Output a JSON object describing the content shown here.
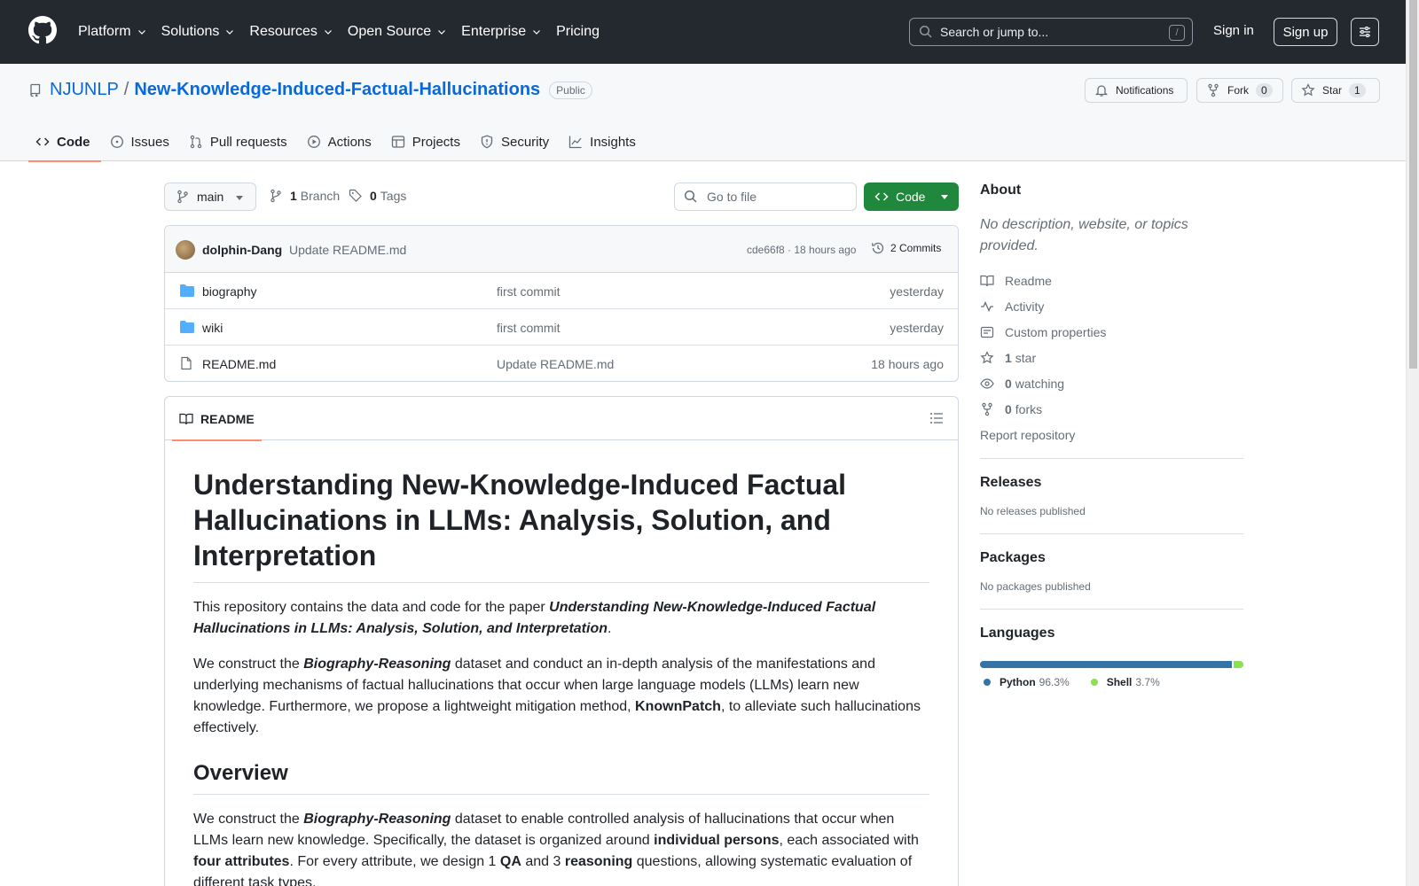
{
  "header": {
    "nav": [
      "Platform",
      "Solutions",
      "Resources",
      "Open Source",
      "Enterprise",
      "Pricing"
    ],
    "search_placeholder": "Search or jump to...",
    "search_shortcut": "/",
    "sign_in": "Sign in",
    "sign_up": "Sign up"
  },
  "repo": {
    "owner": "NJUNLP",
    "separator": "/",
    "name": "New-Knowledge-Induced-Factual-Hallucinations",
    "visibility": "Public",
    "notifications_label": "Notifications",
    "fork_label": "Fork",
    "fork_count": "0",
    "star_label": "Star",
    "star_count": "1"
  },
  "tabs": [
    "Code",
    "Issues",
    "Pull requests",
    "Actions",
    "Projects",
    "Security",
    "Insights"
  ],
  "toolbar": {
    "branch": "main",
    "branch_count": "1",
    "branch_label": "Branch",
    "tag_count": "0",
    "tag_label": "Tags",
    "goto_placeholder": "Go to file",
    "code_button": "Code"
  },
  "commit": {
    "author": "dolphin-Dang",
    "message": "Update README.md",
    "meta": "cde66f8 · 18 hours ago",
    "count": "2 Commits"
  },
  "files": [
    {
      "type": "folder",
      "name": "biography",
      "message": "first commit",
      "time": "yesterday"
    },
    {
      "type": "folder",
      "name": "wiki",
      "message": "first commit",
      "time": "yesterday"
    },
    {
      "type": "file",
      "name": "README.md",
      "message": "Update README.md",
      "time": "18 hours ago"
    }
  ],
  "readme": {
    "tab_label": "README",
    "title": "Understanding New-Knowledge-Induced Factual Hallucinations in LLMs: Analysis, Solution, and Interpretation",
    "p1_pre": "This repository contains the data and code for the paper ",
    "p1_em": "Understanding New-Knowledge-Induced Factual Hallucinations in LLMs: Analysis, Solution, and Interpretation",
    "p1_post": ".",
    "p2_a": "We construct the ",
    "p2_em": "Biography-Reasoning",
    "p2_b": " dataset and conduct an in-depth analysis of the manifestations and underlying mechanisms of factual hallucinations that occur when large language models (LLMs) learn new knowledge. Furthermore, we propose a lightweight mitigation method, ",
    "p2_strong": "KnownPatch",
    "p2_c": ", to alleviate such hallucinations effectively.",
    "overview": "Overview",
    "p3_a": "We construct the ",
    "p3_em": "Biography-Reasoning",
    "p3_b": " dataset to enable controlled analysis of hallucinations that occur when LLMs learn new knowledge. Specifically, the dataset is organized around ",
    "p3_s1": "individual persons",
    "p3_c": ", each associated with ",
    "p3_s2": "four attributes",
    "p3_d": ". For every attribute, we design 1 ",
    "p3_s3": "QA",
    "p3_e": " and 3 ",
    "p3_s4": "reasoning",
    "p3_f": " questions, allowing systematic evaluation of different task types."
  },
  "sidebar": {
    "about_title": "About",
    "about_desc": "No description, website, or topics provided.",
    "readme": "Readme",
    "activity": "Activity",
    "custom_properties": "Custom properties",
    "stars_count": "1",
    "stars_label": "star",
    "watching_count": "0",
    "watching_label": "watching",
    "forks_count": "0",
    "forks_label": "forks",
    "report": "Report repository",
    "releases_title": "Releases",
    "releases_note": "No releases published",
    "packages_title": "Packages",
    "packages_note": "No packages published",
    "languages_title": "Languages",
    "languages": [
      {
        "name": "Python",
        "percent": "96.3%",
        "value": 96.3,
        "color": "#3572A5"
      },
      {
        "name": "Shell",
        "percent": "3.7%",
        "value": 3.7,
        "color": "#89e051"
      }
    ]
  }
}
